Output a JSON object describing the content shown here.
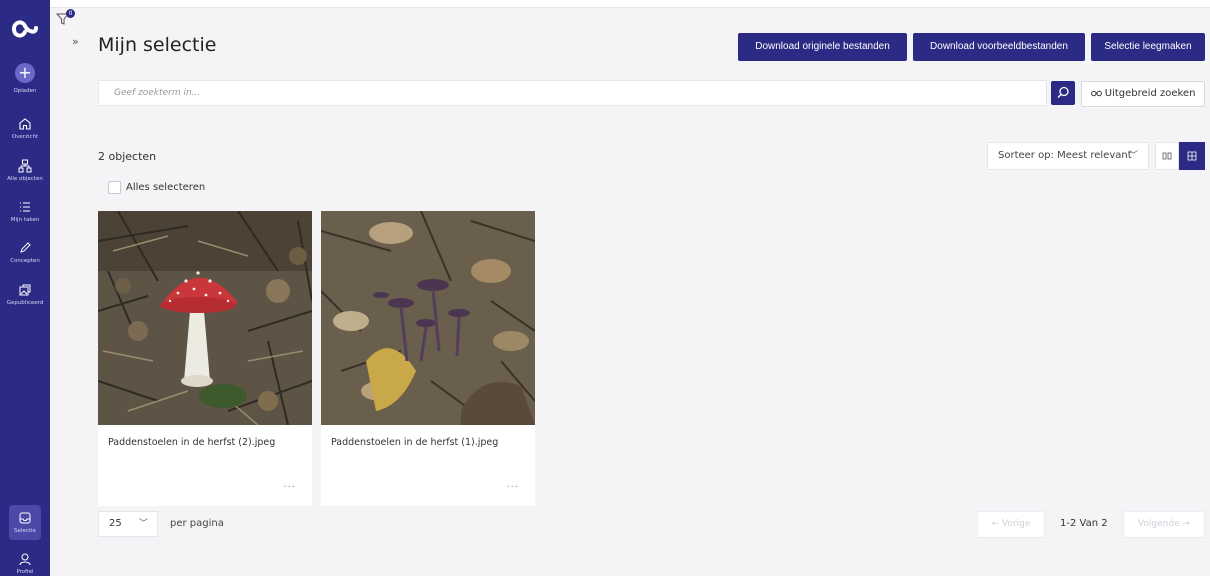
{
  "sidebar": {
    "logo": "logo",
    "items": [
      {
        "label": "Opladen",
        "icon": "plus-icon"
      },
      {
        "label": "Overzicht",
        "icon": "home-icon"
      },
      {
        "label": "Alle objecten",
        "icon": "hierarchy-icon"
      },
      {
        "label": "Mijn taken",
        "icon": "task-list-icon"
      },
      {
        "label": "Concepten",
        "icon": "pencil-icon"
      },
      {
        "label": "Gepubliceerd",
        "icon": "published-icon"
      },
      {
        "label": "Selectie",
        "icon": "inbox-icon"
      },
      {
        "label": "Profiel",
        "icon": "user-icon"
      }
    ]
  },
  "filter": {
    "badge": "0"
  },
  "header": {
    "title": "Mijn selectie",
    "buttons": {
      "download_original": "Download originele bestanden",
      "download_preview": "Download voorbeeldbestanden",
      "clear_selection": "Selectie leegmaken"
    }
  },
  "search": {
    "placeholder": "Geef zoekterm in...",
    "advanced_label": "Uitgebreid zoeken"
  },
  "results": {
    "count_label": "2 objecten",
    "sort_label": "Sorteer op: Meest relevant",
    "select_all_label": "Alles selecteren",
    "items": [
      {
        "name": "Paddenstoelen in de herfst (2).jpeg",
        "more": "..."
      },
      {
        "name": "Paddenstoelen in de herfst (1).jpeg",
        "more": "..."
      }
    ]
  },
  "pagination": {
    "per_page_value": "25",
    "per_page_label": "per pagina",
    "prev_label": "← Vorige",
    "info": "1-2 Van 2",
    "next_label": "Volgende →"
  },
  "colors": {
    "brand": "#2b2a85",
    "background": "#f4f4f6"
  }
}
